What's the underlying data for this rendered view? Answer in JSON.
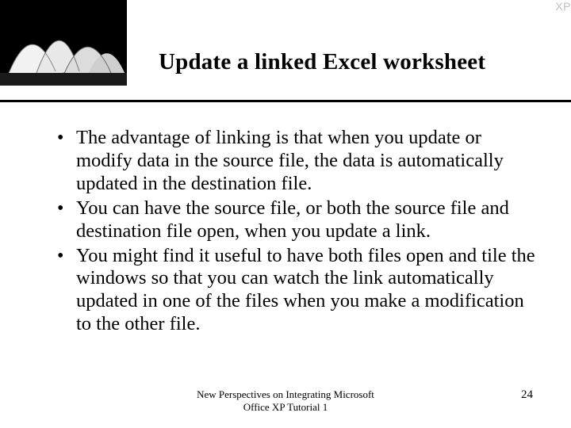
{
  "header": {
    "title": "Update a linked Excel worksheet",
    "badge": "XP"
  },
  "bullets": [
    "The advantage of linking is that when you update or modify data in the source file, the data is automatically updated in the destination file.",
    "You can have the source file, or both the source file and destination file open, when you update a link.",
    "You might find it useful to have both files open and tile the windows so that you can watch the link automatically updated in one of the files when you make a modification to the other file."
  ],
  "footer": {
    "center": "New Perspectives on Integrating Microsoft\nOffice XP Tutorial 1",
    "page": "24"
  }
}
